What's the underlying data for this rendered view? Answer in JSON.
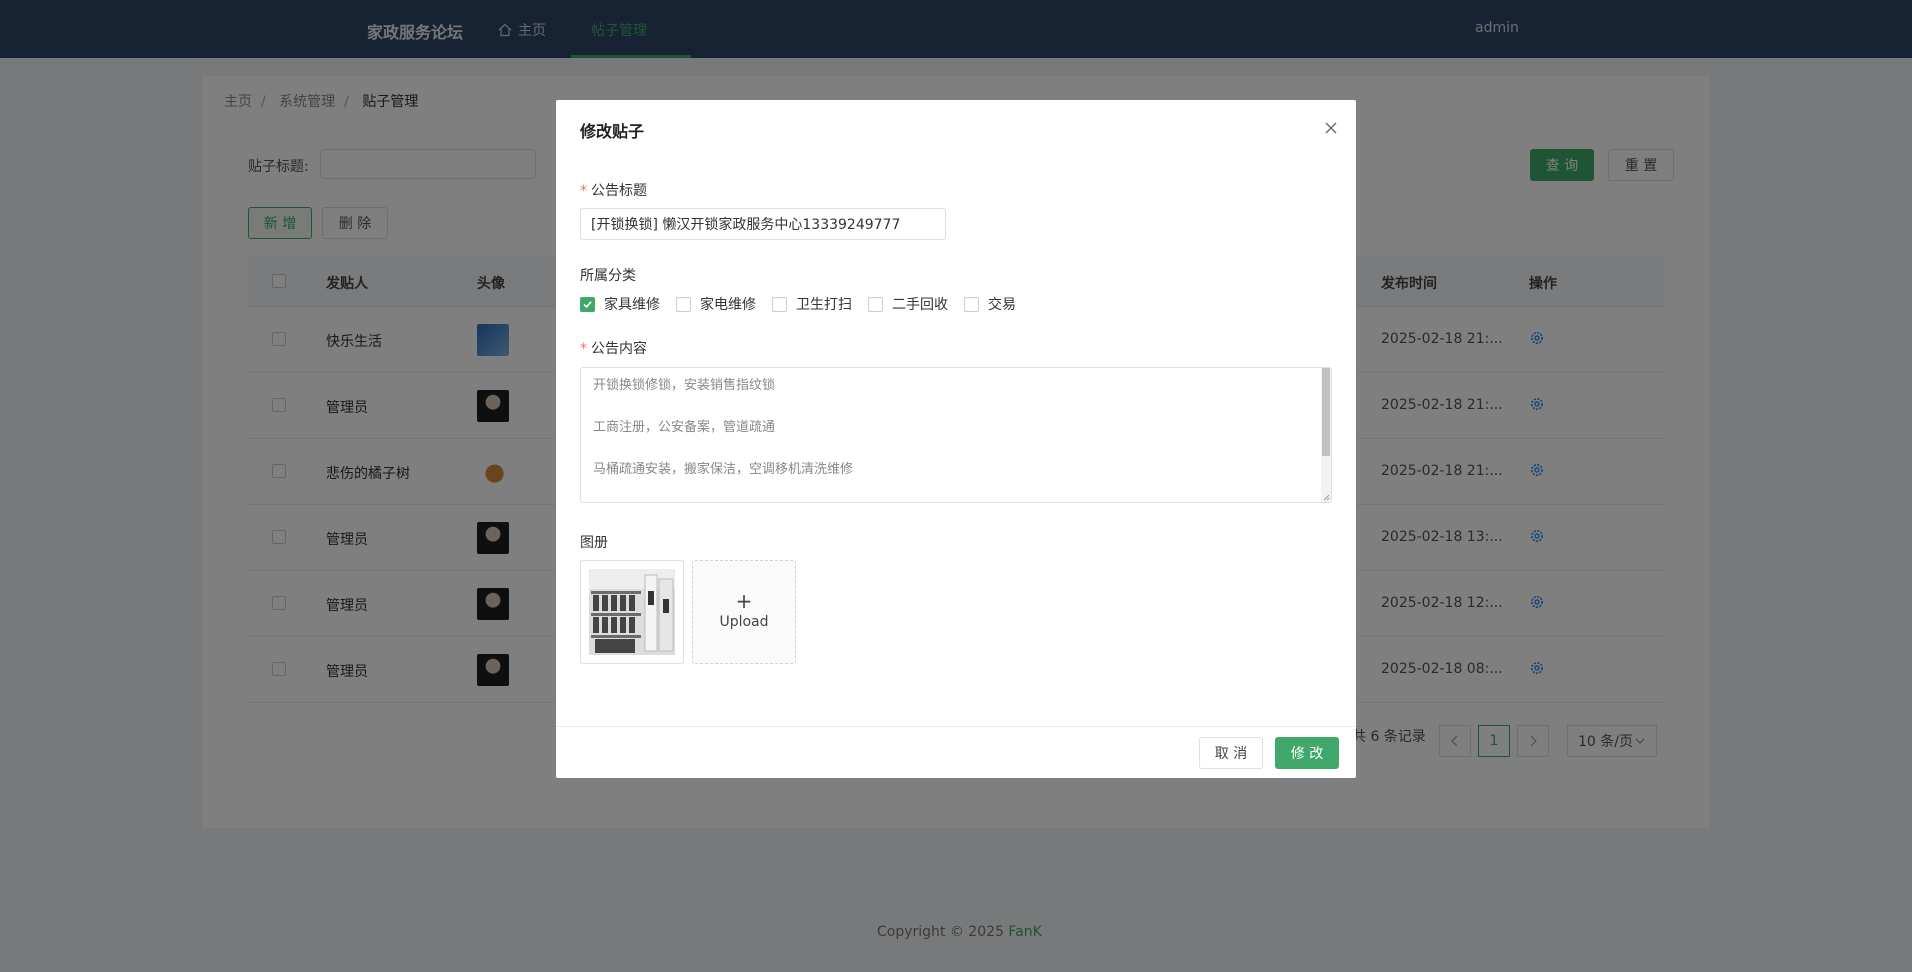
{
  "header": {
    "brand": "家政服务论坛",
    "nav_home": "主页",
    "nav_active": "帖子管理",
    "user": "admin"
  },
  "breadcrumb": [
    "主页",
    "系统管理",
    "贴子管理"
  ],
  "search": {
    "label": "贴子标题:",
    "value": ""
  },
  "buttons": {
    "query": "查 询",
    "reset": "重 置",
    "add": "新 增",
    "delete": "删 除"
  },
  "table": {
    "columns": [
      "发贴人",
      "头像",
      "发布时间",
      "操作"
    ],
    "rows": [
      {
        "poster": "快乐生活",
        "time": "2025-02-18 21:..."
      },
      {
        "poster": "管理员",
        "time": "2025-02-18 21:..."
      },
      {
        "poster": "悲伤的橘子树",
        "time": "2025-02-18 21:..."
      },
      {
        "poster": "管理员",
        "time": "2025-02-18 13:..."
      },
      {
        "poster": "管理员",
        "time": "2025-02-18 12:..."
      },
      {
        "poster": "管理员",
        "time": "2025-02-18 08:..."
      }
    ]
  },
  "pagination": {
    "total": "共 6 条记录",
    "current": "1",
    "page_size": "10 条/页"
  },
  "footer": {
    "copyright": "Copyright © 2025",
    "author": "FanK"
  },
  "dialog": {
    "title": "修改贴子",
    "title_label": "公告标题",
    "title_value": "[开锁换锁] 懒汉开锁家政服务中心13339249777",
    "category_label": "所属分类",
    "categories": [
      {
        "label": "家具维修",
        "checked": true
      },
      {
        "label": "家电维修",
        "checked": false
      },
      {
        "label": "卫生打扫",
        "checked": false
      },
      {
        "label": "二手回收",
        "checked": false
      },
      {
        "label": "交易",
        "checked": false
      }
    ],
    "content_label": "公告内容",
    "content_lines": [
      "开锁换锁修锁，安装销售指纹锁",
      "工商注册，公安备案，管道疏通",
      "马桶疏通安装，搬家保洁，空调移机清洗维修"
    ],
    "album_label": "图册",
    "upload_label": "Upload",
    "cancel": "取 消",
    "submit": "修 改"
  },
  "colors": {
    "accent": "#3fa86a",
    "header": "#2e4766",
    "required": "#f56c6c",
    "gear": "#2d8cf0"
  }
}
